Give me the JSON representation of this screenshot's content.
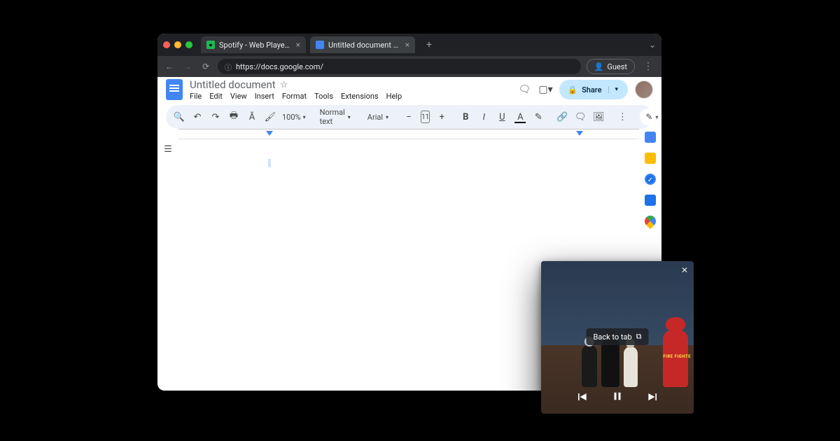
{
  "browser": {
    "tabs": [
      {
        "title": "Spotify - Web Player: Music f",
        "favicon_color": "#1db954"
      },
      {
        "title": "Untitled document - Google D",
        "favicon_color": "#4285f4"
      }
    ],
    "url": "https://docs.google.com/",
    "guest_label": "Guest"
  },
  "docs": {
    "title": "Untitled document",
    "menus": [
      "File",
      "Edit",
      "View",
      "Insert",
      "Format",
      "Tools",
      "Extensions",
      "Help"
    ],
    "share_label": "Share",
    "zoom": "100%",
    "style": "Normal text",
    "font": "Arial",
    "font_size": "11"
  },
  "pip": {
    "back_label": "Back to tab",
    "ff_label": "FIRE\nFIGHTE"
  }
}
